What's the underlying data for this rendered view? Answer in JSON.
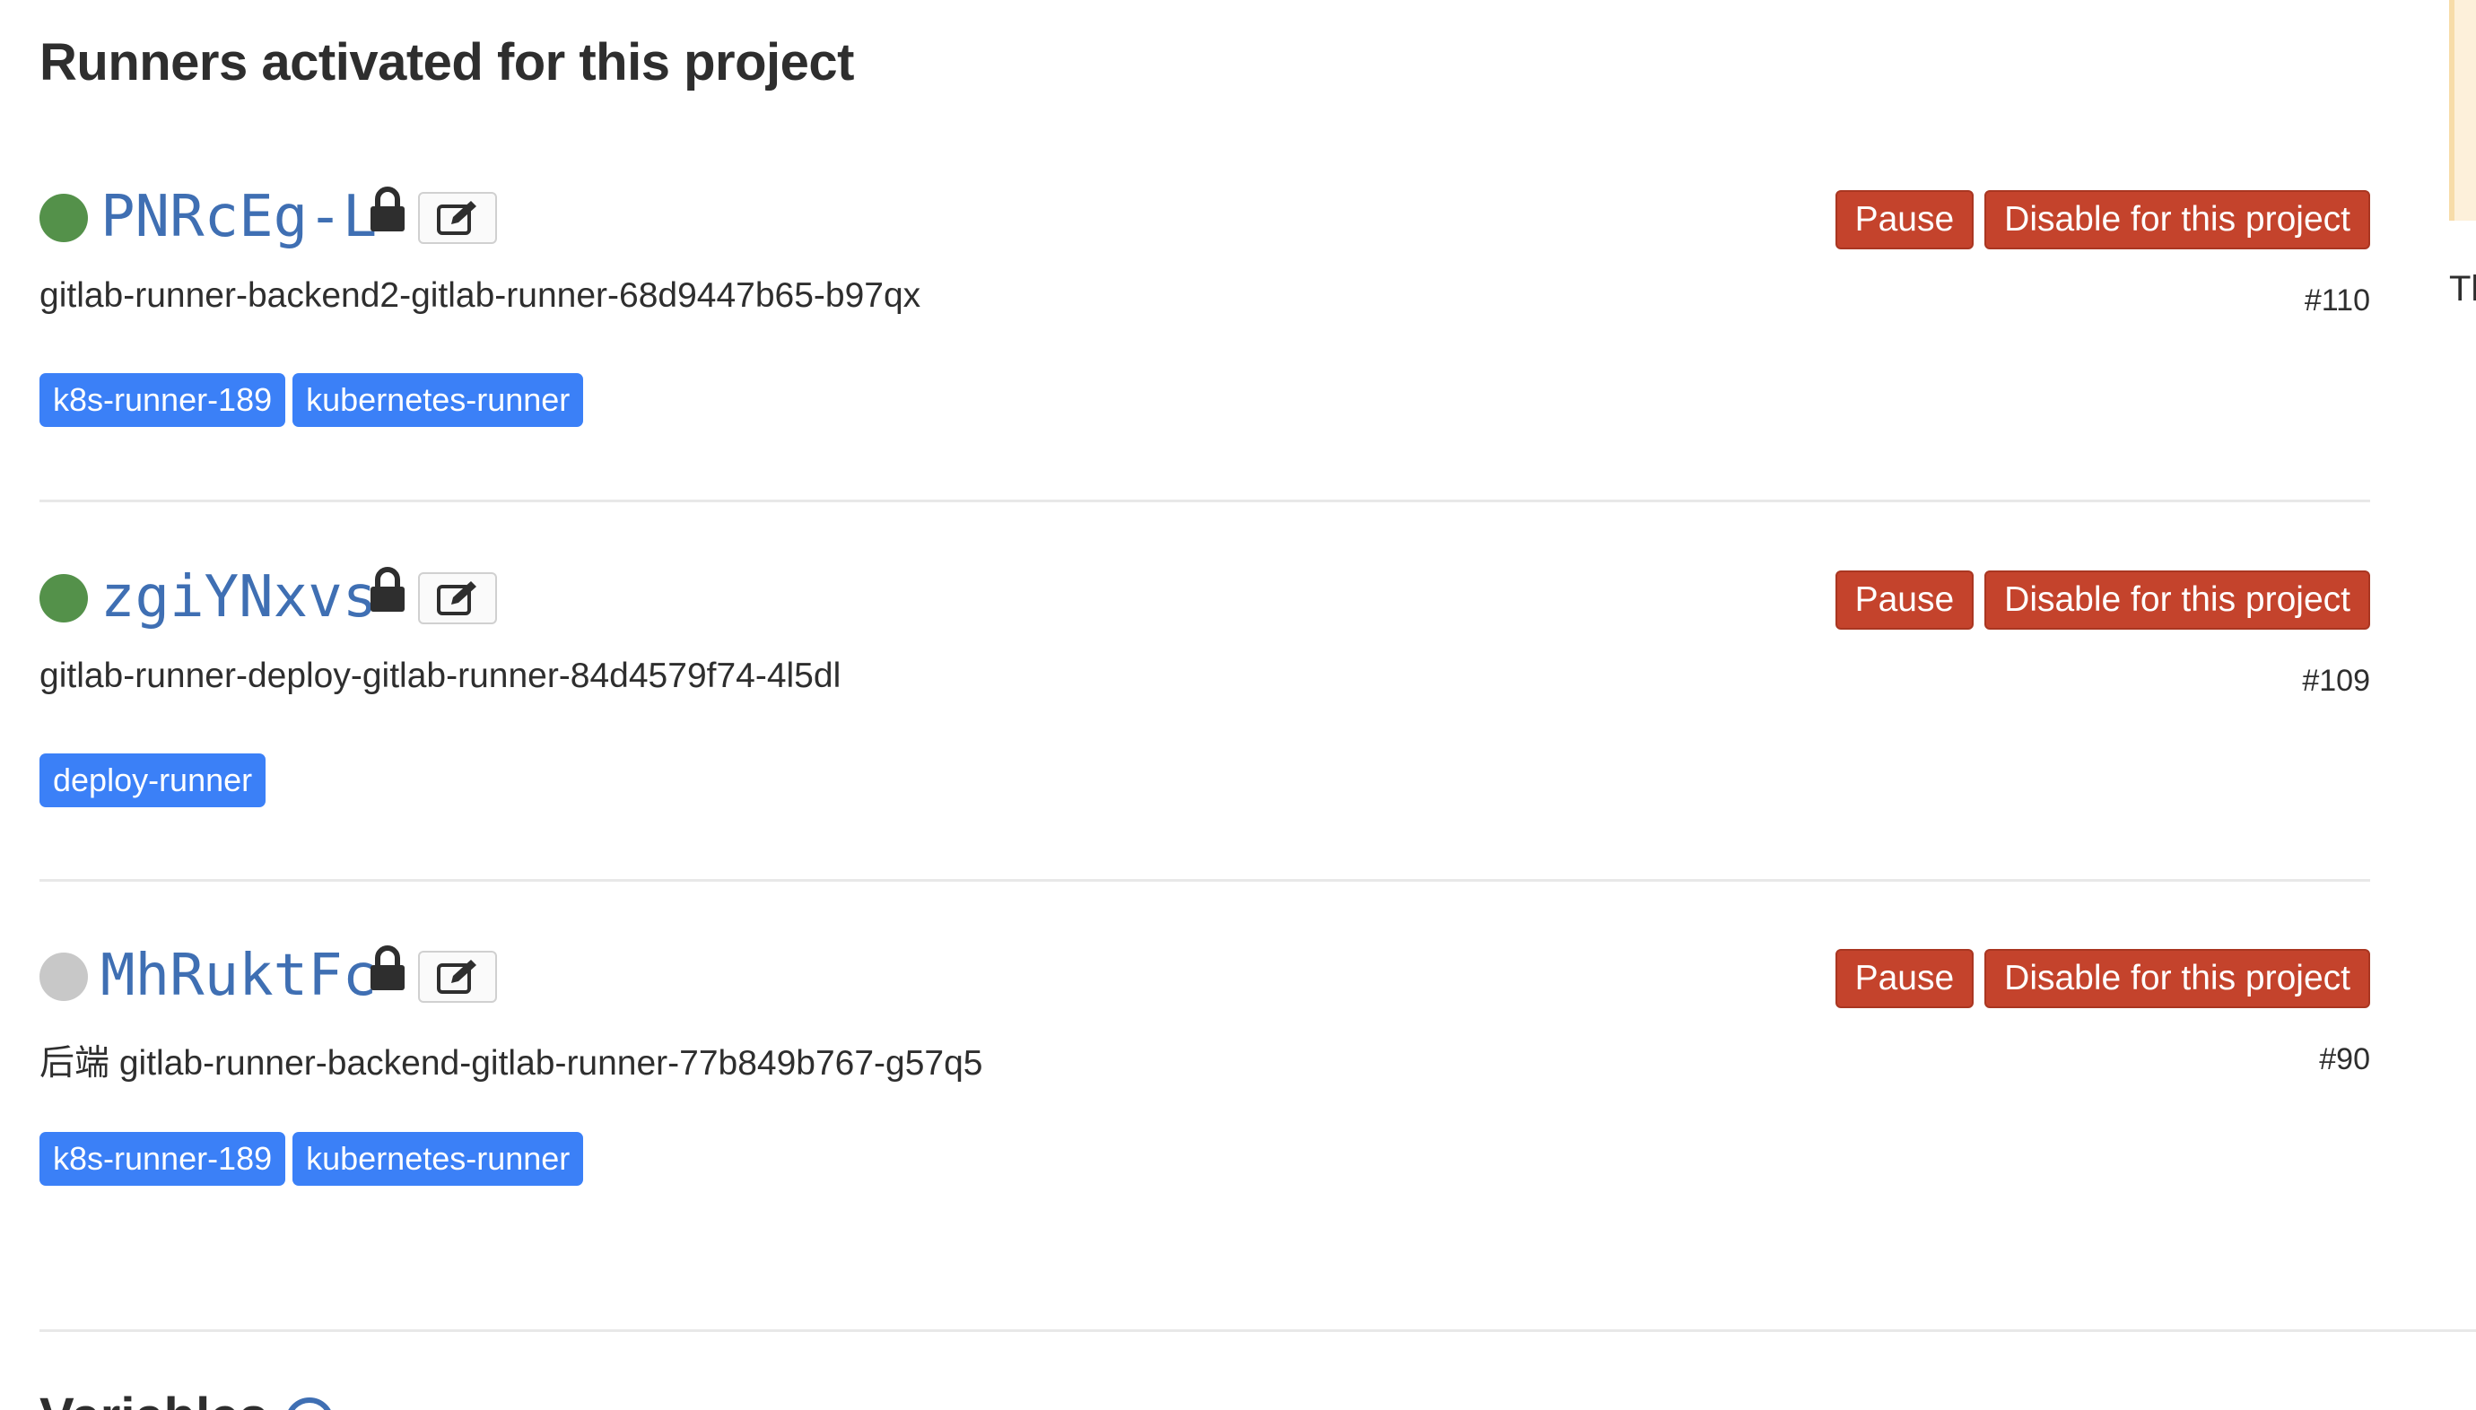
{
  "section": {
    "title": "Runners activated for this project"
  },
  "colors": {
    "online": "#54914a",
    "offline": "#c8c8c8",
    "danger": "#c4432c",
    "tag": "#3b80f7",
    "link": "#3f6fb3"
  },
  "runners": [
    {
      "id": "PNRcEg-L",
      "status": "online",
      "description": "gitlab-runner-backend2-gitlab-runner-68d9447b65-b97qx",
      "number": "#110",
      "tags": [
        "k8s-runner-189",
        "kubernetes-runner"
      ],
      "pause_label": "Pause",
      "disable_label": "Disable for this project"
    },
    {
      "id": "zgiYNxvs",
      "status": "online",
      "description": "gitlab-runner-deploy-gitlab-runner-84d4579f74-4l5dl",
      "number": "#109",
      "tags": [
        "deploy-runner"
      ],
      "pause_label": "Pause",
      "disable_label": "Disable for this project"
    },
    {
      "id": "MhRuktFc",
      "status": "offline",
      "description": "后端 gitlab-runner-backend-gitlab-runner-77b849b767-g57q5",
      "number": "#90",
      "tags": [
        "k8s-runner-189",
        "kubernetes-runner"
      ],
      "pause_label": "Pause",
      "disable_label": "Disable for this project"
    }
  ],
  "sidebar": {
    "text": "Th"
  },
  "next_section": {
    "title": "Variables"
  }
}
